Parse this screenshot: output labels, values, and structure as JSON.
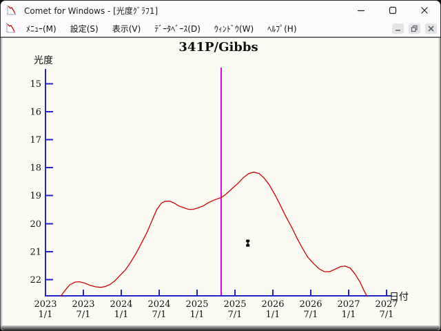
{
  "window": {
    "title": "Comet for Windows - [光度ｸﾞﾗﾌ1]"
  },
  "menubar": {
    "items": [
      {
        "label": "ﾒﾆｭｰ(M)"
      },
      {
        "label": "設定(S)"
      },
      {
        "label": "表示(V)"
      },
      {
        "label": "ﾃﾞｰﾀﾍﾞｰｽ(D)"
      },
      {
        "label": "ｳｨﾝﾄﾞｳ(W)"
      },
      {
        "label": "ﾍﾙﾌﾟ(H)"
      }
    ]
  },
  "chart_data": {
    "type": "line",
    "title": "341P/Gibbs",
    "ylabel": "光度",
    "xlabel": "日付",
    "y_axis_inverted": true,
    "ylim": [
      14.5,
      22.6
    ],
    "xlim": [
      2023.0,
      2027.6
    ],
    "grid": false,
    "y_ticks": [
      15,
      16,
      17,
      18,
      19,
      20,
      21,
      22
    ],
    "x_ticks": [
      {
        "year": "2023",
        "day": "1/1",
        "value": 2023.0
      },
      {
        "year": "2023",
        "day": "7/1",
        "value": 2023.5
      },
      {
        "year": "2024",
        "day": "1/1",
        "value": 2024.0
      },
      {
        "year": "2024",
        "day": "7/1",
        "value": 2024.5
      },
      {
        "year": "2025",
        "day": "1/1",
        "value": 2025.0
      },
      {
        "year": "2025",
        "day": "7/1",
        "value": 2025.5
      },
      {
        "year": "2026",
        "day": "1/1",
        "value": 2026.0
      },
      {
        "year": "2026",
        "day": "7/1",
        "value": 2026.5
      },
      {
        "year": "2027",
        "day": "1/1",
        "value": 2027.0
      },
      {
        "year": "2027",
        "day": "7/1",
        "value": 2027.5
      }
    ],
    "axis_color": "#2323c8",
    "series": [
      {
        "name": "predicted-magnitude-curve",
        "color": "#cc0000",
        "points": [
          [
            2023.2,
            22.6
          ],
          [
            2023.26,
            22.38
          ],
          [
            2023.32,
            22.19
          ],
          [
            2023.39,
            22.09
          ],
          [
            2023.45,
            22.08
          ],
          [
            2023.52,
            22.13
          ],
          [
            2023.59,
            22.21
          ],
          [
            2023.66,
            22.26
          ],
          [
            2023.73,
            22.28
          ],
          [
            2023.79,
            22.25
          ],
          [
            2023.85,
            22.18
          ],
          [
            2023.91,
            22.06
          ],
          [
            2023.97,
            21.89
          ],
          [
            2024.05,
            21.67
          ],
          [
            2024.12,
            21.4
          ],
          [
            2024.19,
            21.09
          ],
          [
            2024.26,
            20.73
          ],
          [
            2024.34,
            20.31
          ],
          [
            2024.41,
            19.86
          ],
          [
            2024.47,
            19.49
          ],
          [
            2024.53,
            19.27
          ],
          [
            2024.58,
            19.2
          ],
          [
            2024.64,
            19.2
          ],
          [
            2024.7,
            19.27
          ],
          [
            2024.76,
            19.37
          ],
          [
            2024.83,
            19.44
          ],
          [
            2024.89,
            19.49
          ],
          [
            2024.95,
            19.49
          ],
          [
            2025.01,
            19.44
          ],
          [
            2025.08,
            19.37
          ],
          [
            2025.15,
            19.25
          ],
          [
            2025.23,
            19.15
          ],
          [
            2025.32,
            19.07
          ],
          [
            2025.39,
            18.93
          ],
          [
            2025.46,
            18.75
          ],
          [
            2025.54,
            18.56
          ],
          [
            2025.61,
            18.36
          ],
          [
            2025.68,
            18.21
          ],
          [
            2025.75,
            18.16
          ],
          [
            2025.82,
            18.21
          ],
          [
            2025.88,
            18.36
          ],
          [
            2025.95,
            18.6
          ],
          [
            2026.03,
            18.98
          ],
          [
            2026.1,
            19.35
          ],
          [
            2026.17,
            19.74
          ],
          [
            2026.25,
            20.14
          ],
          [
            2026.32,
            20.53
          ],
          [
            2026.39,
            20.88
          ],
          [
            2026.46,
            21.2
          ],
          [
            2026.54,
            21.44
          ],
          [
            2026.61,
            21.62
          ],
          [
            2026.68,
            21.72
          ],
          [
            2026.75,
            21.72
          ],
          [
            2026.83,
            21.62
          ],
          [
            2026.89,
            21.54
          ],
          [
            2026.95,
            21.52
          ],
          [
            2027.02,
            21.59
          ],
          [
            2027.08,
            21.79
          ],
          [
            2027.15,
            22.09
          ],
          [
            2027.2,
            22.38
          ],
          [
            2027.24,
            22.6
          ]
        ]
      }
    ],
    "vline": {
      "name": "perihelion-marker-line",
      "value": 2025.32,
      "color": "#e800e8"
    },
    "observation_marker": {
      "name": "observation-data-point",
      "x": 2025.67,
      "mag": 20.7,
      "color": "#000000"
    }
  }
}
